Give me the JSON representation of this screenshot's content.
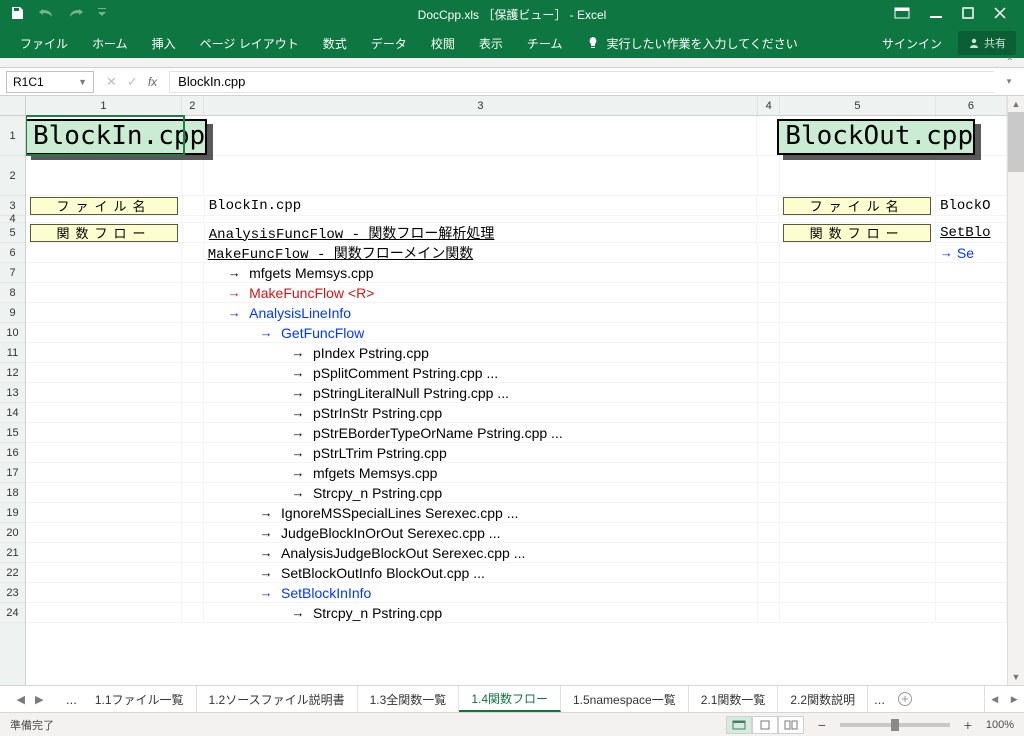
{
  "titlebar": {
    "title": "DocCpp.xls ［保護ビュー］ - Excel"
  },
  "ribbon": {
    "tabs": [
      "ファイル",
      "ホーム",
      "挿入",
      "ページ レイアウト",
      "数式",
      "データ",
      "校閲",
      "表示",
      "チーム"
    ],
    "tellme": "実行したい作業を入力してください",
    "signin": "サインイン",
    "share": "共有"
  },
  "formulabar": {
    "namebox": "R1C1",
    "formula": "BlockIn.cpp"
  },
  "columns": [
    "1",
    "2",
    "3",
    "4",
    "5",
    "6"
  ],
  "row_numbers": [
    "1",
    "2",
    "3",
    "4",
    "5",
    "6",
    "7",
    "8",
    "9",
    "10",
    "11",
    "12",
    "13",
    "14",
    "15",
    "16",
    "17",
    "18",
    "19",
    "20",
    "21",
    "22",
    "23",
    "24"
  ],
  "cells": {
    "title_left": "BlockIn.cpp",
    "title_right": "BlockOut.cpp",
    "label_file": "ファイル名",
    "label_flow": "関数フロー",
    "r3c3": "BlockIn.cpp",
    "r3c6": "BlockO",
    "r5c3": "AnalysisFuncFlow - 関数フロー解析処理",
    "r5c6": "SetBlo",
    "r6c3": "MakeFuncFlow - 関数フローメイン関数",
    "r6c6": "Se",
    "r7": "mfgets Memsys.cpp",
    "r8": "MakeFuncFlow <R>",
    "r9": "AnalysisLineInfo",
    "r10": "GetFuncFlow",
    "r11": "pIndex Pstring.cpp",
    "r12": "pSplitComment Pstring.cpp ...",
    "r13": "pStringLiteralNull Pstring.cpp ...",
    "r14": "pStrInStr Pstring.cpp",
    "r15": "pStrEBorderTypeOrName Pstring.cpp ...",
    "r16": "pStrLTrim Pstring.cpp",
    "r17": "mfgets Memsys.cpp",
    "r18": "Strcpy_n Pstring.cpp",
    "r19": "IgnoreMSSpecialLines Serexec.cpp ...",
    "r20": "JudgeBlockInOrOut Serexec.cpp ...",
    "r21": "AnalysisJudgeBlockOut Serexec.cpp ...",
    "r22": "SetBlockOutInfo BlockOut.cpp ...",
    "r23": "SetBlockInInfo",
    "r24": "Strcpy_n Pstring.cpp"
  },
  "arrows": {
    "r": "→"
  },
  "tabs": {
    "items": [
      "1.1ファイル一覧",
      "1.2ソースファイル説明書",
      "1.3全関数一覧",
      "1.4関数フロー",
      "1.5namespace一覧",
      "2.1関数一覧",
      "2.2関数説明"
    ],
    "active_index": 3,
    "ellipsis": "..."
  },
  "statusbar": {
    "ready": "準備完了",
    "zoom": "100%"
  }
}
